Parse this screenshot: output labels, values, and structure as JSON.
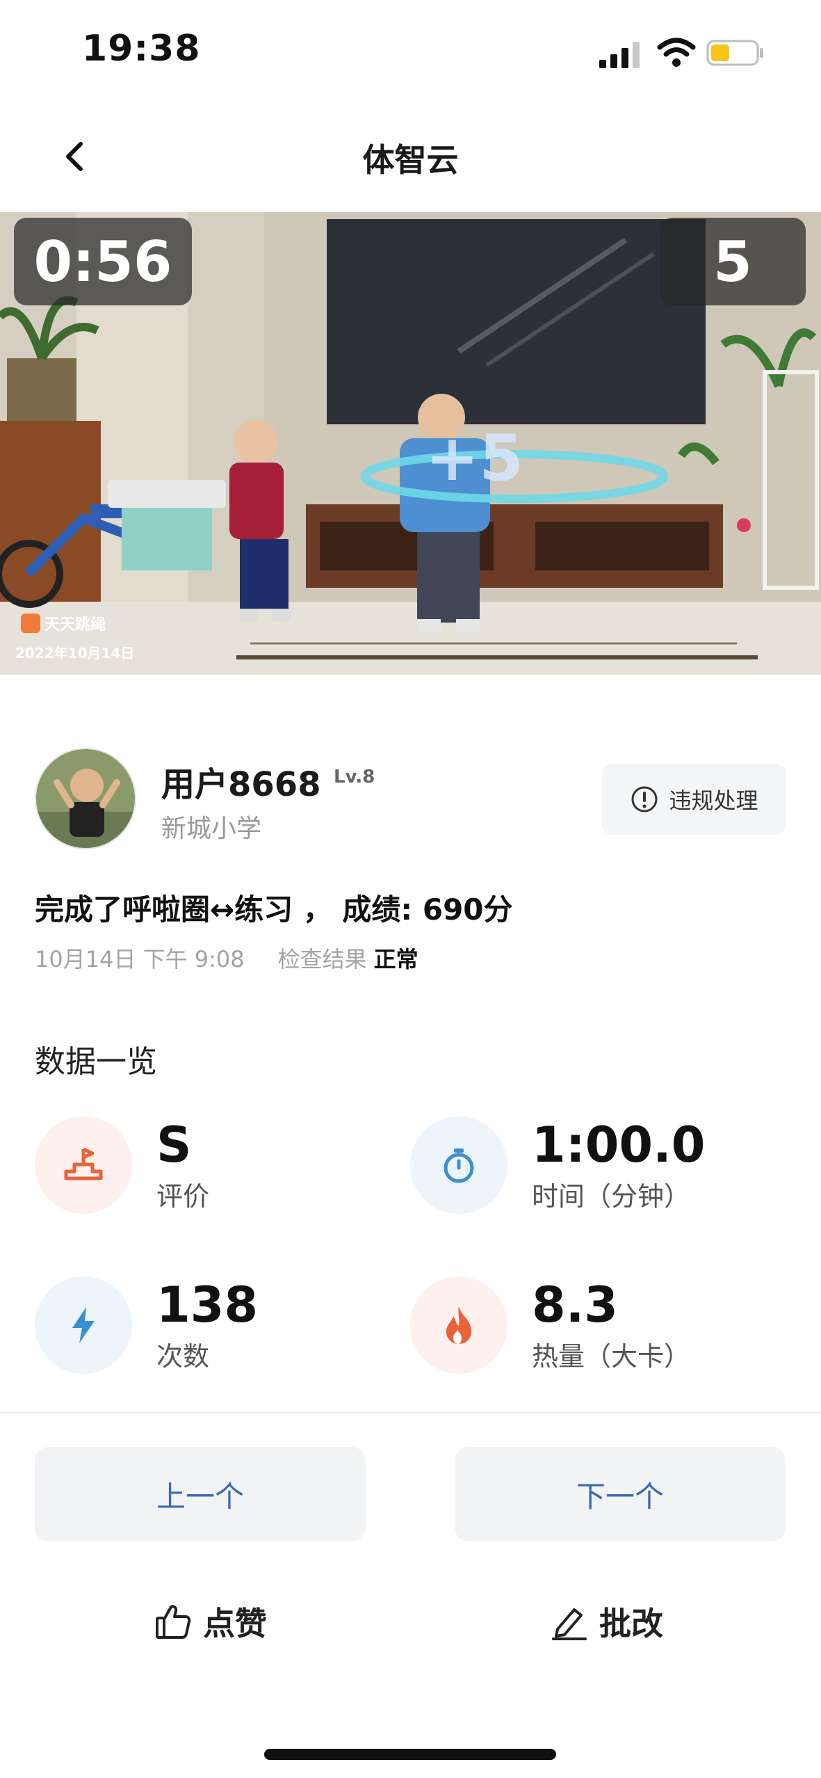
{
  "status_bar": {
    "time": "19:38"
  },
  "nav": {
    "title": "体智云"
  },
  "video": {
    "timer": "0:56",
    "count": "5",
    "plus_label": "+5",
    "watermark_brand": "天天跳绳",
    "watermark_date": "2022年10月14日"
  },
  "user": {
    "name": "用户8668",
    "level": "Lv.8",
    "school": "新城小学"
  },
  "report_button": {
    "label": "违规处理"
  },
  "record": {
    "title": "完成了呼啦圈↔练习 ， 成绩: 690分",
    "time": "10月14日 下午 9:08",
    "check_label": "检查结果",
    "check_value": "正常"
  },
  "stats_section": {
    "title": "数据一览",
    "items": [
      {
        "value": "S",
        "label": "评价",
        "icon": "podium-icon",
        "color": "#e8623a"
      },
      {
        "value": "1:00.0",
        "label": "时间（分钟）",
        "icon": "stopwatch-icon",
        "color": "#3a8fd0"
      },
      {
        "value": "138",
        "label": "次数",
        "icon": "lightning-icon",
        "color": "#3a8fd0"
      },
      {
        "value": "8.3",
        "label": "热量（大卡）",
        "icon": "flame-icon",
        "color": "#e8623a"
      }
    ]
  },
  "navigation": {
    "prev_label": "上一个",
    "next_label": "下一个"
  },
  "actions": {
    "like_label": "点赞",
    "review_label": "批改"
  }
}
